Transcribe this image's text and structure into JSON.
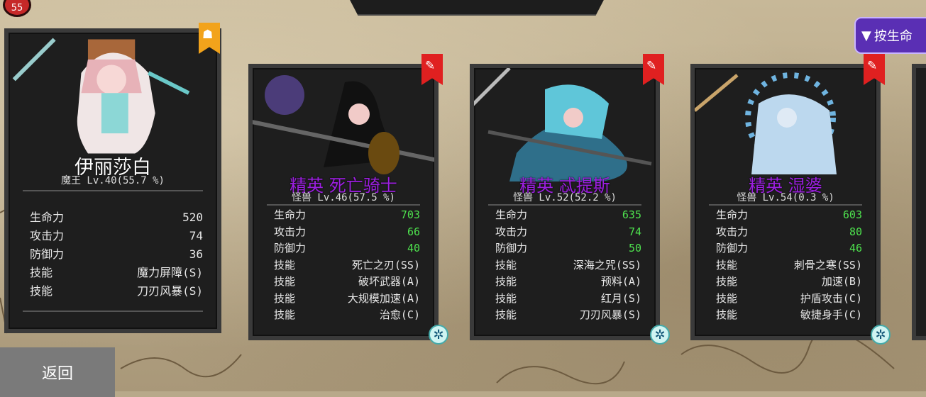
{
  "top": {
    "badge": "55"
  },
  "sort_button": {
    "label": "按生命",
    "icon": "filter-icon"
  },
  "back_button": {
    "label": "返回"
  },
  "cards": [
    {
      "name": "伊丽莎白",
      "level": "魔王 Lv.40(55.7 %)",
      "ribbon": "gold",
      "ribbon_icon": "demon-icon",
      "stats": [
        {
          "label": "生命力",
          "value": "520"
        },
        {
          "label": "攻击力",
          "value": "74"
        },
        {
          "label": "防御力",
          "value": "36"
        },
        {
          "label": "技能",
          "value": "魔力屏障(S)"
        },
        {
          "label": "技能",
          "value": "刀刃风暴(S)"
        }
      ]
    },
    {
      "name": "精英 死亡骑士",
      "level": "怪兽 Lv.46(57.5 %)",
      "ribbon": "red",
      "ribbon_icon": "sword-icon",
      "stats": [
        {
          "label": "生命力",
          "value": "703",
          "green": true
        },
        {
          "label": "攻击力",
          "value": "66",
          "green": true
        },
        {
          "label": "防御力",
          "value": "40",
          "green": true
        },
        {
          "label": "技能",
          "value": "死亡之刃(SS)"
        },
        {
          "label": "技能",
          "value": "破坏武器(A)"
        },
        {
          "label": "技能",
          "value": "大规模加速(A)"
        },
        {
          "label": "技能",
          "value": "治愈(C)"
        }
      ]
    },
    {
      "name": "精英 忒提斯",
      "level": "怪兽 Lv.52(52.2 %)",
      "ribbon": "red",
      "ribbon_icon": "sword-icon",
      "stats": [
        {
          "label": "生命力",
          "value": "635",
          "green": true
        },
        {
          "label": "攻击力",
          "value": "74",
          "green": true
        },
        {
          "label": "防御力",
          "value": "50",
          "green": true
        },
        {
          "label": "技能",
          "value": "深海之咒(SS)"
        },
        {
          "label": "技能",
          "value": "预料(A)"
        },
        {
          "label": "技能",
          "value": "红月(S)"
        },
        {
          "label": "技能",
          "value": "刀刃风暴(S)"
        }
      ]
    },
    {
      "name": "精英 湿婆",
      "level": "怪兽 Lv.54(0.3 %)",
      "ribbon": "red",
      "ribbon_icon": "sword-icon",
      "stats": [
        {
          "label": "生命力",
          "value": "603",
          "green": true
        },
        {
          "label": "攻击力",
          "value": "80",
          "green": true
        },
        {
          "label": "防御力",
          "value": "46",
          "green": true
        },
        {
          "label": "技能",
          "value": "刺骨之寒(SS)"
        },
        {
          "label": "技能",
          "value": "加速(B)"
        },
        {
          "label": "技能",
          "value": "护盾攻击(C)"
        },
        {
          "label": "技能",
          "value": "敏捷身手(C)"
        }
      ]
    }
  ],
  "colors": {
    "elite_name": "#9c1fe0",
    "stat_green": "#4ee34e",
    "sort_button": "#5a2fb4"
  }
}
